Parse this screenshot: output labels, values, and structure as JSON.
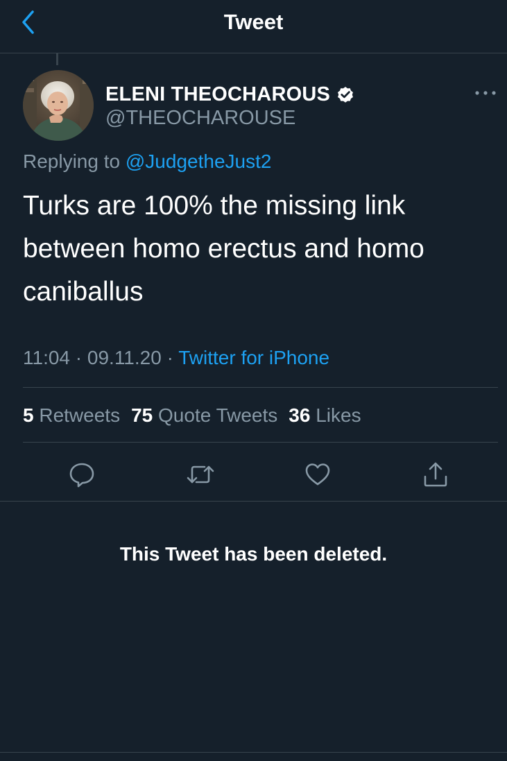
{
  "header": {
    "title": "Tweet",
    "back_icon": "chevron-left-icon"
  },
  "tweet": {
    "author": {
      "display_name": "ELENI THEOCHAROUS",
      "handle": "@THEOCHAROUSE",
      "verified": true
    },
    "reply": {
      "prefix": "Replying to",
      "to_handle": "@JudgetheJust2"
    },
    "text": "Turks are 100% the missing link between homo erectus and homo caniballus",
    "meta": {
      "time": "11:04",
      "separator": "·",
      "date": "09.11.20",
      "source": "Twitter for iPhone"
    },
    "stats": {
      "retweets": {
        "count": "5",
        "label": "Retweets"
      },
      "quotes": {
        "count": "75",
        "label": "Quote Tweets"
      },
      "likes": {
        "count": "36",
        "label": "Likes"
      }
    },
    "actions": [
      "reply-icon",
      "retweet-icon",
      "like-icon",
      "share-icon"
    ]
  },
  "deleted_notice": "This Tweet has been deleted.",
  "colors": {
    "background": "#15202b",
    "accent": "#1da1f2",
    "secondary_text": "#8899a6",
    "divider": "#38444d"
  }
}
